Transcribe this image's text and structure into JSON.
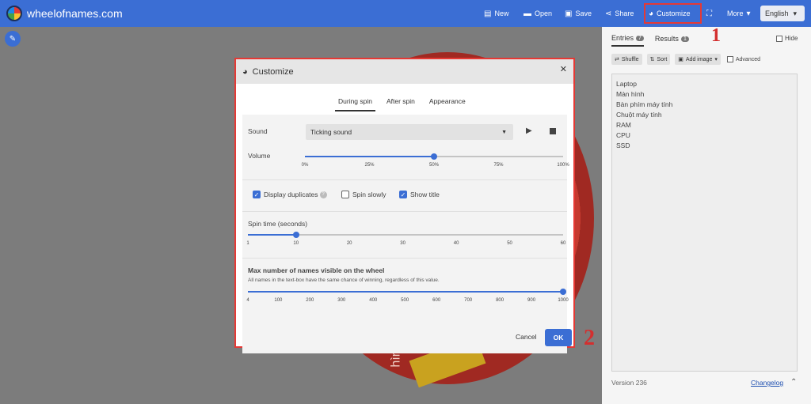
{
  "app": {
    "title": "wheelofnames.com"
  },
  "toolbar": {
    "new": "New",
    "open": "Open",
    "save": "Save",
    "share": "Share",
    "customize": "Customize",
    "more": "More",
    "language": "English"
  },
  "panel": {
    "tab_entries": "Entries",
    "entries_count": "7",
    "tab_results": "Results",
    "results_count": "1",
    "hide": "Hide",
    "shuffle": "Shuffle",
    "sort": "Sort",
    "add_image": "Add image",
    "advanced": "Advanced",
    "entries": [
      "Laptop",
      "Màn hình",
      "Bàn phím máy tính",
      "Chuột máy tính",
      "RAM",
      "CPU",
      "SSD"
    ],
    "version": "Version 236",
    "changelog": "Changelog"
  },
  "wheel": {
    "slice_text": "hình"
  },
  "annotations": {
    "n1": "1",
    "n2": "2"
  },
  "dialog": {
    "title": "Customize",
    "tabs": [
      "During spin",
      "After spin",
      "Appearance"
    ],
    "active_tab": "During spin",
    "sound_label": "Sound",
    "sound_value": "Ticking sound",
    "volume_label": "Volume",
    "volume_level": 0.5,
    "volume_ticks": [
      "0%",
      "25%",
      "50%",
      "75%",
      "100%"
    ],
    "display_duplicates": "Display duplicates",
    "display_duplicates_checked": true,
    "spin_slowly": "Spin slowly",
    "spin_slowly_checked": false,
    "show_title": "Show title",
    "show_title_checked": true,
    "spin_time_label": "Spin time (seconds)",
    "spin_time_value": 10,
    "spin_time_ticks": [
      "1",
      "10",
      "20",
      "30",
      "40",
      "50",
      "60"
    ],
    "max_names_label": "Max number of names visible on the wheel",
    "max_names_note": "All names in the text-box have the same chance of winning, regardless of this value.",
    "max_names_value": 1000,
    "max_names_ticks": [
      "4",
      "100",
      "200",
      "300",
      "400",
      "500",
      "600",
      "700",
      "800",
      "900",
      "1000"
    ],
    "cancel": "Cancel",
    "ok": "OK"
  },
  "colors": {
    "accent": "#3b6ed4",
    "highlight": "#e53935"
  }
}
